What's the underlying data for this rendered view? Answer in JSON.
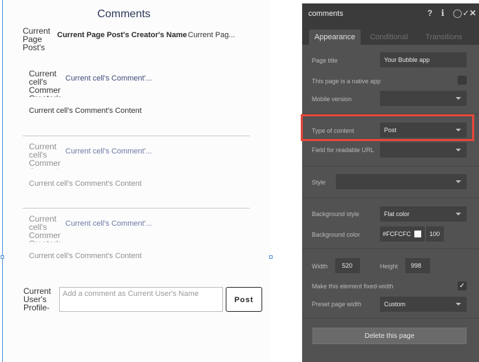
{
  "canvas": {
    "title": "Comments",
    "post_header": {
      "avatar_text": "Current Page Post's",
      "creator_name": "Current Page Post's Creator's Name",
      "content_preview": "Current Pag..."
    },
    "comments": [
      {
        "avatar_text": "Current cell's Commen Creator's",
        "creator_preview": "Current cell's Comment'...",
        "content": "Current cell's Comment's Content"
      },
      {
        "avatar_text": "Current cell's Commen Creator's",
        "creator_preview": "Current cell's Comment'...",
        "content": "Current cell's Comment's Content"
      },
      {
        "avatar_text": "Current cell's Commen Creator's",
        "creator_preview": "Current cell's Comment'...",
        "content": "Current cell's Comment's Content"
      }
    ],
    "user_avatar_text": "Current User's Profile-",
    "comment_input_placeholder": "Add a comment as Current User's Name",
    "post_button": "Post"
  },
  "panel": {
    "title": "comments",
    "header_icons": [
      "help-icon",
      "info-icon",
      "comment-icon",
      "check-icon",
      "close-icon"
    ],
    "header_glyphs": {
      "help": "?",
      "info": "i",
      "comment": "◯",
      "check": "✓",
      "close": "✕"
    },
    "tabs": [
      "Appearance",
      "Conditional",
      "Transitions"
    ],
    "active_tab": "Appearance",
    "fields": {
      "page_title_label": "Page title",
      "page_title_value": "Your Bubble app",
      "native_app_label": "This page is a native app",
      "mobile_version_label": "Mobile version",
      "mobile_version_value": "",
      "type_of_content_label": "Type of content",
      "type_of_content_value": "Post",
      "readable_url_label": "Field for readable URL",
      "readable_url_value": "",
      "style_label": "Style",
      "style_value": "",
      "background_style_label": "Background style",
      "background_style_value": "Flat color",
      "background_color_label": "Background color",
      "background_color_value": "#FCFCFC",
      "background_opacity": "100",
      "width_label": "Width",
      "width_value": "520",
      "height_label": "Height",
      "height_value": "998",
      "fixed_width_label": "Make this element fixed-width",
      "fixed_width_checked": true,
      "preset_width_label": "Preset page width",
      "preset_width_value": "Custom"
    },
    "delete_button": "Delete this page"
  },
  "colors": {
    "highlight": "#e7473a",
    "panel_bg": "#525252",
    "panel_header": "#3b3b3b",
    "selection_blue": "#4a90d9",
    "page_bg": "#FCFCFC"
  }
}
